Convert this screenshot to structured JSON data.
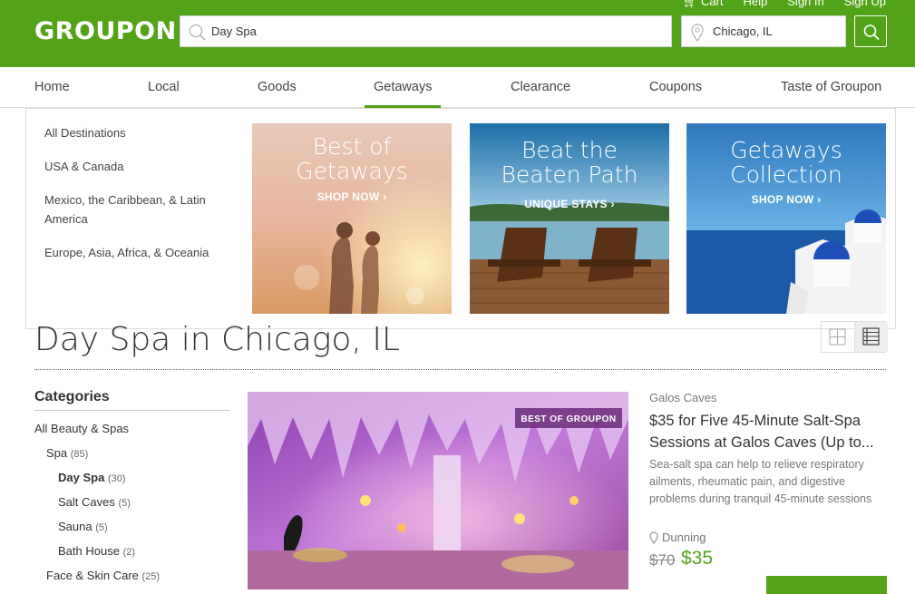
{
  "header": {
    "logo": "GROUPON",
    "top_links": [
      "Cart",
      "Help",
      "Sign In",
      "Sign Up"
    ],
    "search_value": "Day Spa",
    "location_value": "Chicago, IL"
  },
  "nav": {
    "items": [
      "Home",
      "Local",
      "Goods",
      "Getaways",
      "Clearance",
      "Coupons",
      "Taste of Groupon"
    ],
    "active": "Getaways"
  },
  "dropdown": {
    "links": [
      "All Destinations",
      "USA & Canada",
      "Mexico, the Caribbean, & Latin America",
      "Europe, Asia, Africa, & Oceania"
    ],
    "promos": [
      {
        "title": "Best of\nGetaways",
        "cta": "SHOP NOW ›"
      },
      {
        "title": "Beat the\nBeaten Path",
        "cta": "UNIQUE STAYS ›"
      },
      {
        "title": "Getaways\nCollection",
        "cta": "SHOP NOW ›"
      }
    ]
  },
  "page": {
    "title": "Day Spa in Chicago, IL"
  },
  "categories": {
    "heading": "Categories",
    "items": [
      {
        "label": "All Beauty & Spas",
        "count": ""
      },
      {
        "label": "Spa",
        "count": "(85)"
      },
      {
        "label": "Day Spa",
        "count": "(30)"
      },
      {
        "label": "Salt Caves",
        "count": "(5)"
      },
      {
        "label": "Sauna",
        "count": "(5)"
      },
      {
        "label": "Bath House",
        "count": "(2)"
      },
      {
        "label": "Face & Skin Care",
        "count": "(25)"
      }
    ]
  },
  "deal": {
    "badge": "BEST OF GROUPON",
    "merchant": "Galos Caves",
    "title": "$35 for Five 45-Minute Salt-Spa Sessions at Galos Caves (Up to...",
    "description": "Sea-salt spa can help to relieve respiratory ailments, rheumatic pain, and digestive problems during tranquil 45-minute sessions",
    "location": "Dunning",
    "original_price": "$70",
    "price": "$35"
  },
  "colors": {
    "brand_green": "#53a318"
  }
}
